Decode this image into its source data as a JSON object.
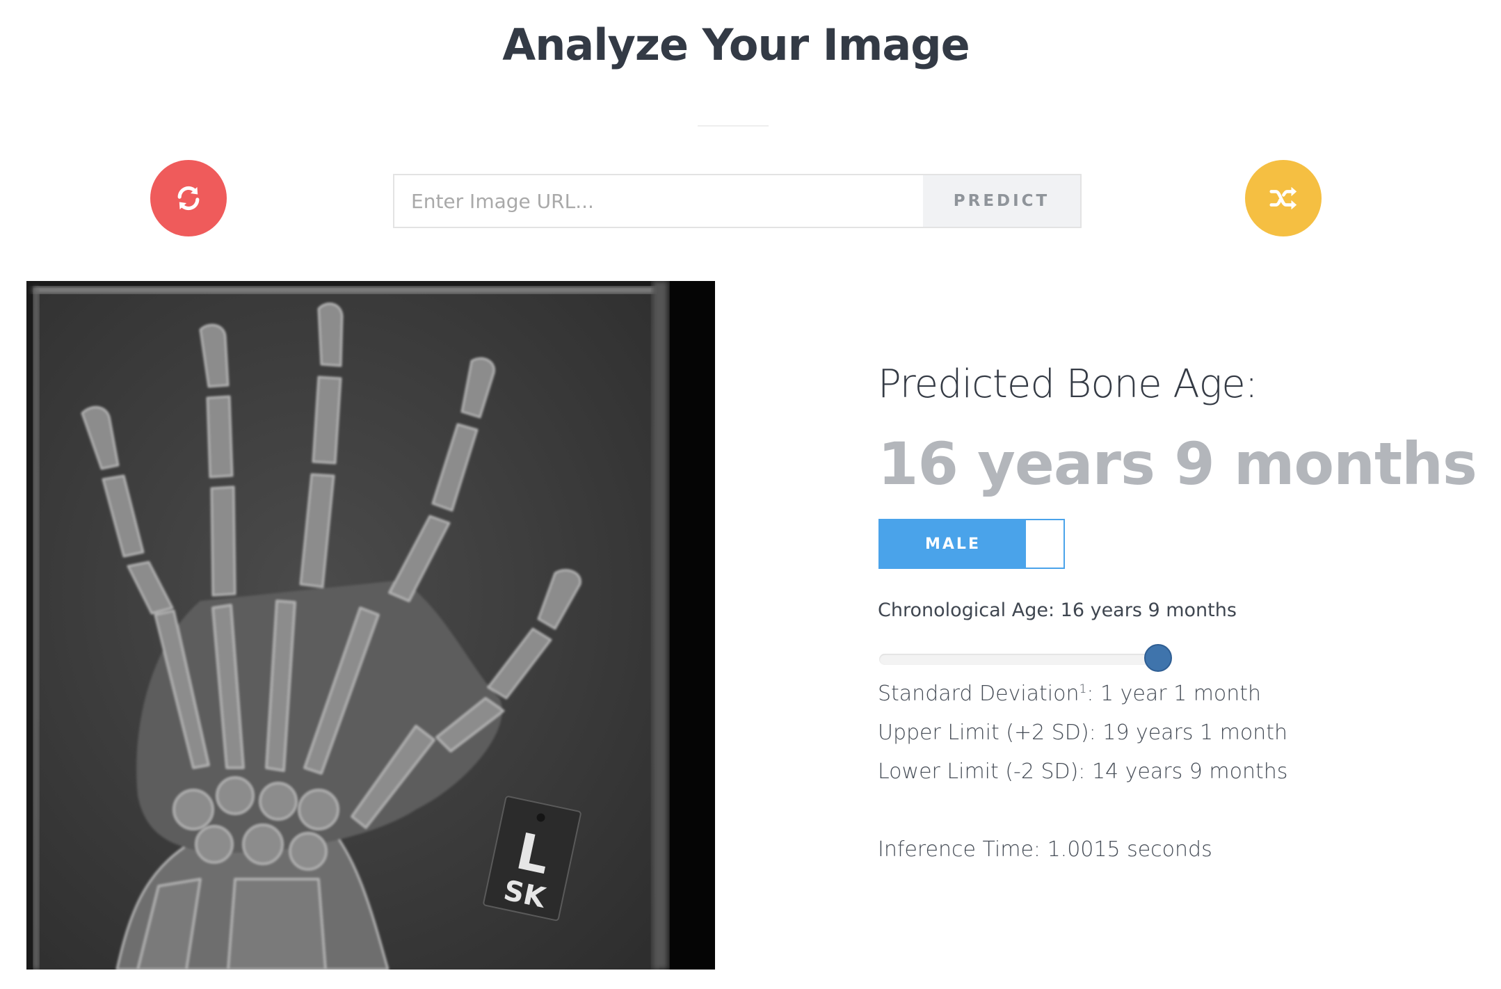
{
  "header": {
    "title": "Analyze Your Image"
  },
  "url_form": {
    "placeholder": "Enter Image URL...",
    "predict_label": "PREDICT"
  },
  "actions": {
    "refresh_icon": "refresh-icon",
    "shuffle_icon": "shuffle-icon"
  },
  "xray_image": {
    "marker_letter": "L",
    "marker_initials": "SK"
  },
  "results": {
    "predicted_label": "Predicted Bone Age:",
    "predicted_value": "16 years 9 months",
    "sex_toggle_label": "MALE",
    "chronological_label": "Chronological Age: 16 years 9 months",
    "chronological_slider_fraction": 0.96,
    "sd_label": "Standard Deviation",
    "sd_footnote": "1",
    "sd_value": ": 1 year 1 month",
    "upper_limit": "Upper Limit (+2 SD): 19 years 1 month",
    "lower_limit": "Lower Limit (-2 SD): 14 years 9 months",
    "inference_time": "Inference Time: 1.0015 seconds"
  },
  "colors": {
    "refresh_button": "#ef5b5b",
    "shuffle_button": "#f5bf42",
    "toggle_active": "#4aa3ea",
    "slider_thumb": "#3f74ac",
    "predicted_value": "#b3b6bb"
  }
}
